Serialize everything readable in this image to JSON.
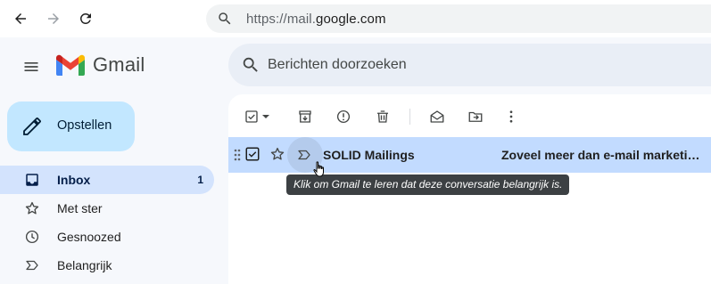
{
  "browser": {
    "url_scheme": "https://mail.",
    "url_domain": "google.com"
  },
  "app": {
    "logo_text": "Gmail"
  },
  "search": {
    "placeholder": "Berichten doorzoeken"
  },
  "compose": {
    "label": "Opstellen"
  },
  "sidebar": {
    "items": [
      {
        "label": "Inbox",
        "count": "1",
        "icon": "inbox-icon"
      },
      {
        "label": "Met ster",
        "icon": "star-icon"
      },
      {
        "label": "Gesnoozed",
        "icon": "clock-icon"
      },
      {
        "label": "Belangrijk",
        "icon": "important-icon"
      }
    ]
  },
  "toolbar": {
    "icons": [
      "select-checkbox-icon",
      "select-dropdown-icon",
      "archive-icon",
      "report-spam-icon",
      "delete-icon",
      "mark-read-icon",
      "move-to-icon",
      "more-icon"
    ]
  },
  "messages": [
    {
      "sender": "SOLID Mailings",
      "subject": "Zoveel meer dan e-mail marketi…",
      "selected": true
    }
  ],
  "tooltip": {
    "text": "Klik om Gmail te leren dat deze conversatie belangrijk is."
  },
  "colors": {
    "accent": "#0b57d0",
    "compose_bg": "#c2e7ff",
    "selected_row": "#c2dbff",
    "active_nav": "#d3e3fd"
  }
}
